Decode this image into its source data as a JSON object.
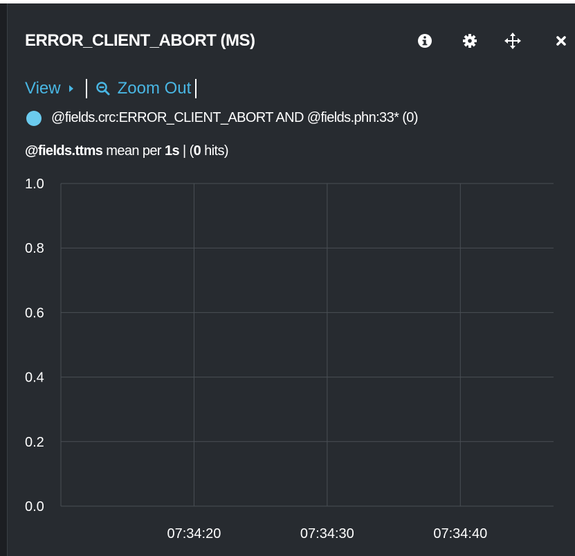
{
  "panel": {
    "title": "ERROR_CLIENT_ABORT (MS)",
    "icons": [
      "info-icon",
      "gear-icon",
      "move-icon",
      "close-icon"
    ],
    "controls": {
      "view_label": "View",
      "zoom_out_label": "Zoom Out"
    },
    "query": {
      "text": "@fields.crc:ERROR_CLIENT_ABORT AND @fields.phn:33* (0)",
      "color": "#6bcbee"
    },
    "stats": {
      "field": "@fields.ttms",
      "mid": "mean per",
      "interval": "1s",
      "pipe": "|",
      "hits_open": "(",
      "hits_count": "0",
      "hits_close": "hits)"
    }
  },
  "colors": {
    "background": "#272b30",
    "accent": "#49b6e3",
    "grid": "#4a4f55"
  },
  "chart_data": {
    "type": "line",
    "title": "",
    "xlabel": "",
    "ylabel": "",
    "ylim": [
      0,
      1
    ],
    "yticks": [
      "0.0",
      "0.2",
      "0.4",
      "0.6",
      "0.8",
      "1.0"
    ],
    "xlim": [
      "07:34:10",
      "07:34:47"
    ],
    "xticks": [
      "07:34:20",
      "07:34:30",
      "07:34:40"
    ],
    "series": [],
    "grid": true
  }
}
